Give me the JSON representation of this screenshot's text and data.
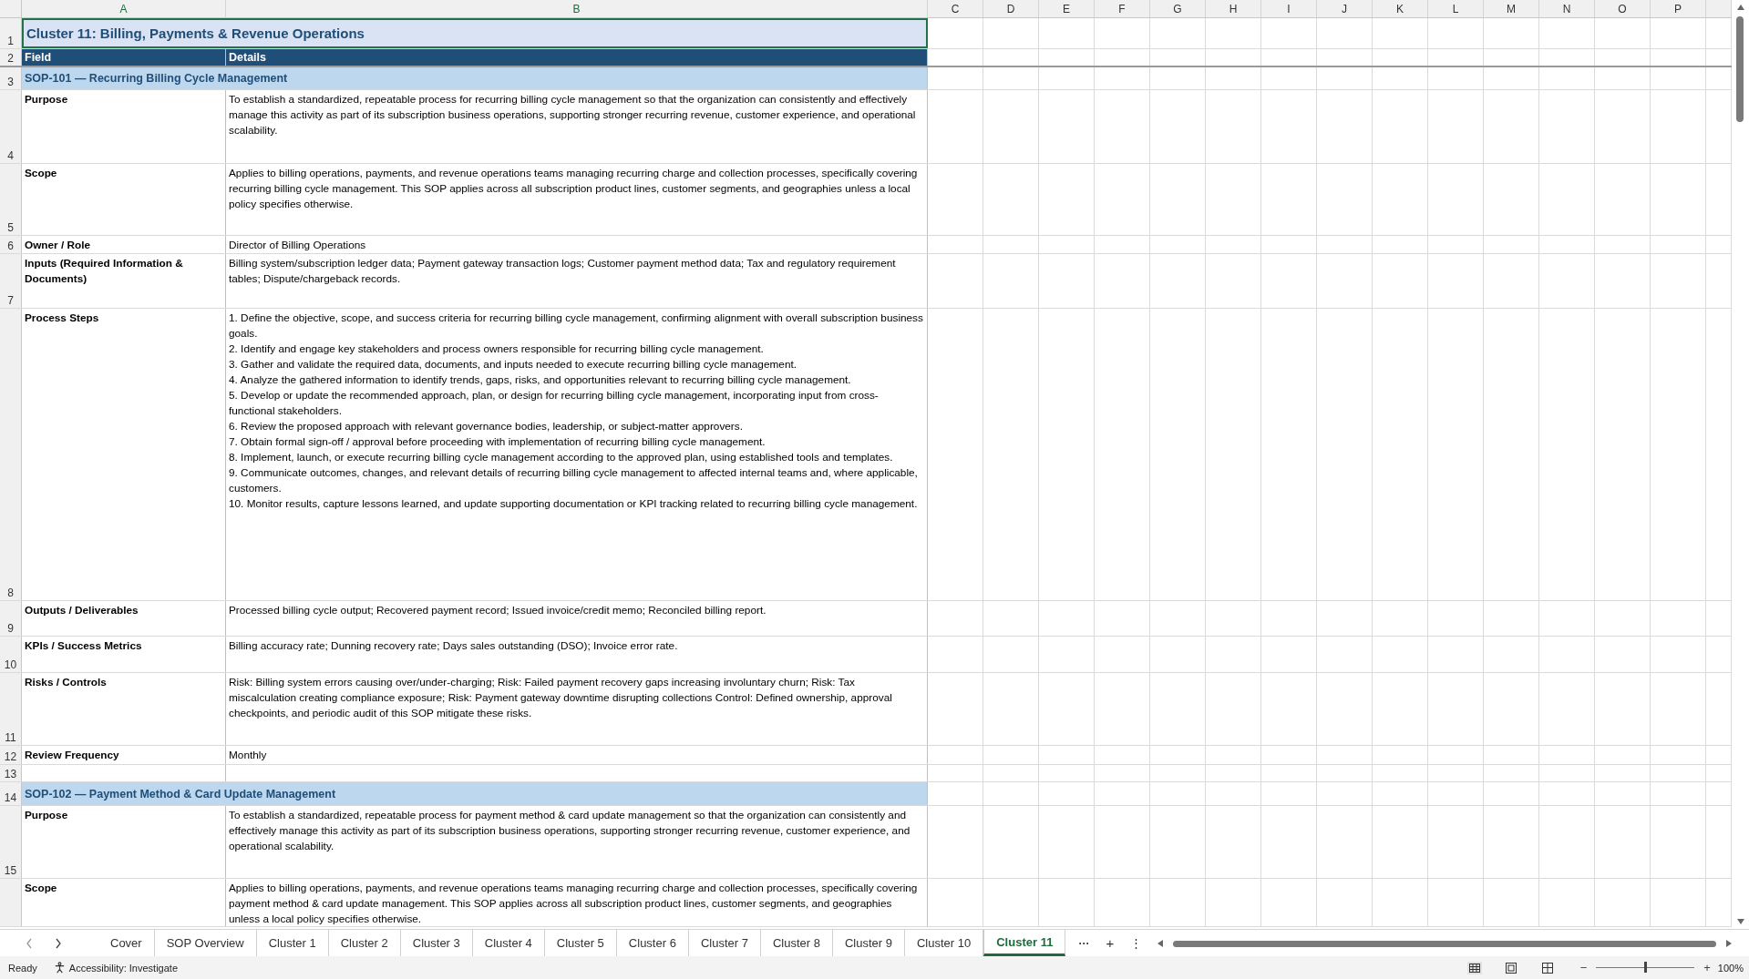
{
  "column_headers": [
    "A",
    "B",
    "C",
    "D",
    "E",
    "F",
    "G",
    "H",
    "I",
    "J",
    "K",
    "L",
    "M",
    "N",
    "O",
    "P"
  ],
  "rows": [
    {
      "number": "1",
      "kind": "title",
      "selected": true,
      "text": "Cluster 11: Billing, Payments & Revenue Operations"
    },
    {
      "number": "2",
      "kind": "header",
      "selected": false,
      "field": "Field",
      "details": "Details"
    },
    {
      "number": "3",
      "kind": "section",
      "selected": false,
      "text": "SOP-101 — Recurring Billing Cycle Management"
    },
    {
      "number": "4",
      "kind": "field",
      "selected": false,
      "field": "Purpose",
      "details": [
        "To establish a standardized, repeatable process for recurring billing cycle management so that the organization can consistently and effectively manage this activity as part of its subscription business operations, supporting stronger recurring revenue, customer experience, and operational scalability."
      ]
    },
    {
      "number": "5",
      "kind": "field",
      "selected": false,
      "field": "Scope",
      "details": [
        "Applies to billing operations, payments, and revenue operations teams managing recurring charge and collection processes, specifically covering recurring billing cycle management. This SOP applies across all subscription product lines, customer segments, and geographies unless a local policy specifies otherwise."
      ]
    },
    {
      "number": "6",
      "kind": "field",
      "selected": false,
      "field": "Owner / Role",
      "details": [
        "Director of Billing Operations"
      ]
    },
    {
      "number": "7",
      "kind": "field",
      "selected": false,
      "field": "Inputs (Required Information & Documents)",
      "details": [
        "Billing system/subscription ledger data; Payment gateway transaction logs; Customer payment method data; Tax and regulatory requirement tables; Dispute/chargeback records."
      ]
    },
    {
      "number": "8",
      "kind": "field",
      "selected": false,
      "field": "Process Steps",
      "details": [
        "1. Define the objective, scope, and success criteria for recurring billing cycle management, confirming alignment with overall subscription business goals.",
        "2. Identify and engage key stakeholders and process owners responsible for recurring billing cycle management.",
        "3. Gather and validate the required data, documents, and inputs needed to execute recurring billing cycle management.",
        "4. Analyze the gathered information to identify trends, gaps, risks, and opportunities relevant to recurring billing cycle management.",
        "5. Develop or update the recommended approach, plan, or design for recurring billing cycle management, incorporating input from cross-functional stakeholders.",
        "6. Review the proposed approach with relevant governance bodies, leadership, or subject-matter approvers.",
        "7. Obtain formal sign-off / approval before proceeding with implementation of recurring billing cycle management.",
        "8. Implement, launch, or execute recurring billing cycle management according to the approved plan, using established tools and templates.",
        "9. Communicate outcomes, changes, and relevant details of recurring billing cycle management to affected internal teams and, where applicable, customers.",
        "10. Monitor results, capture lessons learned, and update supporting documentation or KPI tracking related to recurring billing cycle management."
      ]
    },
    {
      "number": "9",
      "kind": "field",
      "selected": false,
      "field": "Outputs / Deliverables",
      "details": [
        "Processed billing cycle output; Recovered payment record; Issued invoice/credit memo; Reconciled billing report."
      ]
    },
    {
      "number": "10",
      "kind": "field",
      "selected": false,
      "field": "KPIs / Success Metrics",
      "details": [
        "Billing accuracy rate; Dunning recovery rate; Days sales outstanding (DSO); Invoice error rate."
      ]
    },
    {
      "number": "11",
      "kind": "field",
      "selected": false,
      "field": "Risks / Controls",
      "details": [
        "Risk: Billing system errors causing over/under-charging; Risk: Failed payment recovery gaps increasing involuntary churn; Risk: Tax miscalculation creating compliance exposure; Risk: Payment gateway downtime disrupting collections Control: Defined ownership, approval checkpoints, and periodic audit of this SOP mitigate these risks."
      ]
    },
    {
      "number": "12",
      "kind": "field",
      "selected": false,
      "field": "Review Frequency",
      "details": [
        "Monthly"
      ]
    },
    {
      "number": "13",
      "kind": "blank",
      "selected": false
    },
    {
      "number": "14",
      "kind": "section",
      "selected": false,
      "text": "SOP-102 — Payment Method & Card Update Management"
    },
    {
      "number": "15",
      "kind": "field",
      "selected": false,
      "field": "Purpose",
      "details": [
        "To establish a standardized, repeatable process for payment method & card update management so that the organization can consistently and effectively manage this activity as part of its subscription business operations, supporting stronger recurring revenue, customer experience, and operational scalability."
      ]
    },
    {
      "kind": "field",
      "selected": false,
      "field": "Scope",
      "details": [
        "Applies to billing operations, payments, and revenue operations teams managing recurring charge and collection processes, specifically covering payment method & card update management. This SOP applies across all subscription product lines, customer segments, and geographies unless a local policy specifies otherwise."
      ]
    }
  ],
  "sheet_tabs": [
    {
      "label": "Cover",
      "selected": false
    },
    {
      "label": "SOP Overview",
      "selected": false
    },
    {
      "label": "Cluster 1",
      "selected": false
    },
    {
      "label": "Cluster 2",
      "selected": false
    },
    {
      "label": "Cluster 3",
      "selected": false
    },
    {
      "label": "Cluster 4",
      "selected": false
    },
    {
      "label": "Cluster 5",
      "selected": false
    },
    {
      "label": "Cluster 6",
      "selected": false
    },
    {
      "label": "Cluster 7",
      "selected": false
    },
    {
      "label": "Cluster 8",
      "selected": false
    },
    {
      "label": "Cluster 9",
      "selected": false
    },
    {
      "label": "Cluster 10",
      "selected": false
    },
    {
      "label": "Cluster 11",
      "selected": true
    }
  ],
  "tab_controls": [
    "···",
    "+",
    "⋮"
  ],
  "status_bar": {
    "status": "Ready",
    "accessibility": "Accessibility: Investigate",
    "zoom_out": "−",
    "zoom_in": "+",
    "zoom": "100%",
    "zoom_slider": {
      "level": 0.5
    }
  }
}
